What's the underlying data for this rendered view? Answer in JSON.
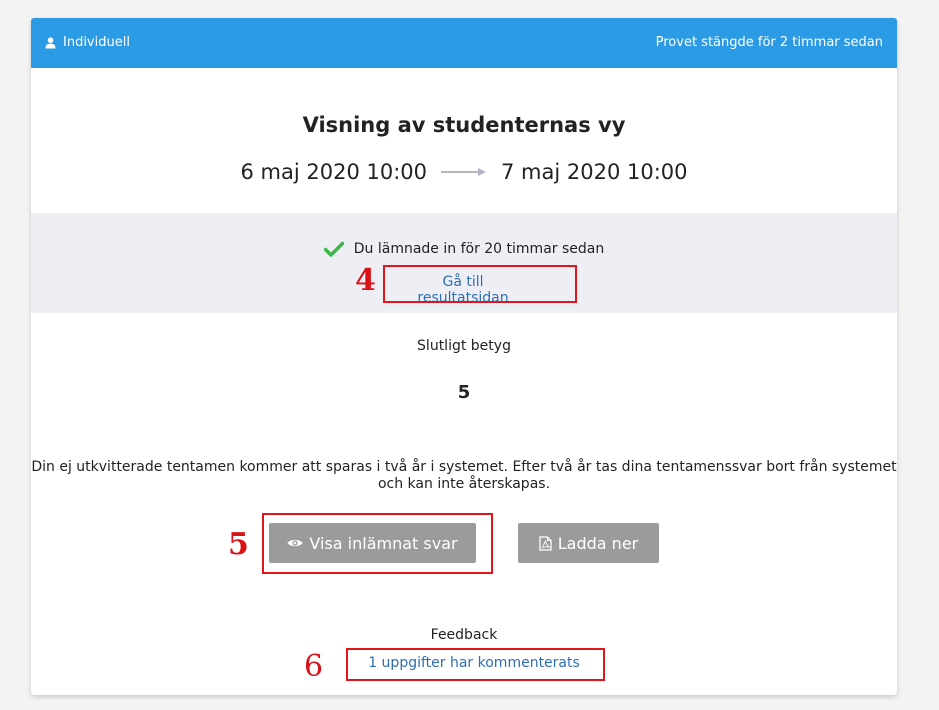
{
  "header": {
    "mode_label": "Individuell",
    "status_text": "Provet stängde för 2 timmar sedan",
    "color": "#2c9be6"
  },
  "exam": {
    "title": "Visning av studenternas vy",
    "start": "6 maj 2020 10:00",
    "end": "7 maj 2020 10:00"
  },
  "submission": {
    "status_text": "Du lämnade in för 20 timmar sedan",
    "status_icon": "check-icon",
    "result_link": "Gå till resultatsidan"
  },
  "grade": {
    "label": "Slutligt betyg",
    "value": "5"
  },
  "notice": "Din ej utkvitterade tentamen kommer att sparas i två år i systemet. Efter två år tas dina tentamenssvar bort från systemet och kan inte återskapas.",
  "actions": {
    "view_answer": "Visa inlämnat svar",
    "download": "Ladda ner"
  },
  "feedback": {
    "label": "Feedback",
    "link": "1 uppgifter har kommenterats"
  },
  "annotations": {
    "marker_4": "4",
    "marker_5": "5",
    "marker_6": "6",
    "color": "#e3141b"
  }
}
